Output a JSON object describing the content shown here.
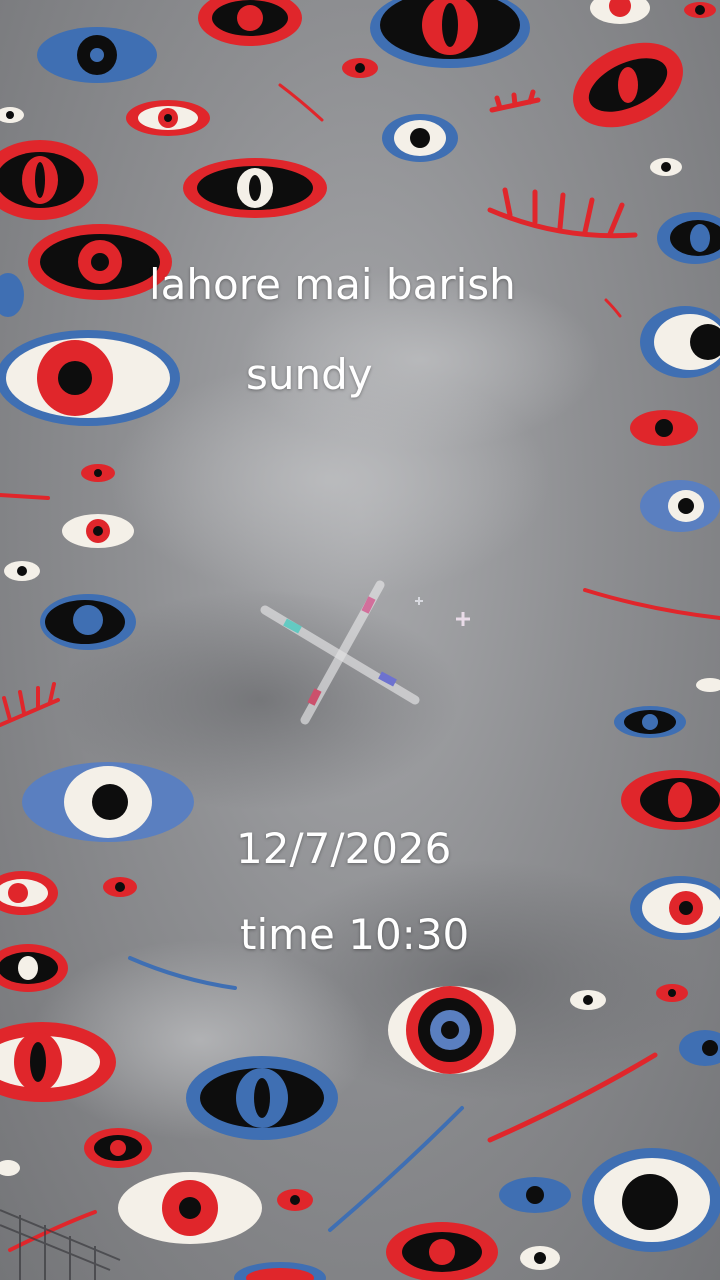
{
  "overlay": {
    "line1": "lahore mai barish",
    "line2": "sundy",
    "date": "12/7/2026",
    "time": "time 10:30"
  },
  "colors": {
    "sky": "#8e8f92",
    "eye_red": "#e0262b",
    "eye_blue": "#3f6fb3",
    "eye_black": "#0d0d0d",
    "eye_white": "#f4f0e8",
    "text": "#ffffff"
  }
}
